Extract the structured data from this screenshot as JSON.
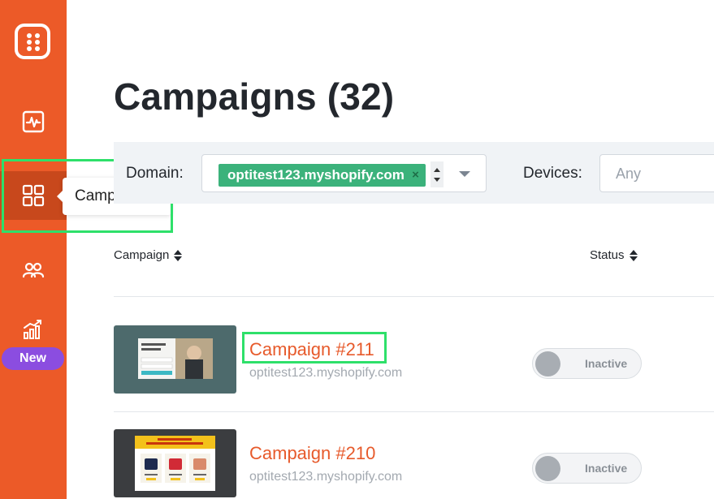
{
  "sidebar": {
    "new_badge": "New",
    "colors": {
      "background": "#ec5a28",
      "active": "#c8481c",
      "badge": "#8b4de0"
    },
    "items": [
      {
        "icon": "analytics-icon"
      },
      {
        "icon": "grid-icon",
        "active": true
      },
      {
        "icon": "users-icon"
      },
      {
        "icon": "bar-chart-icon"
      }
    ]
  },
  "tooltip": {
    "text": "Campaigns"
  },
  "page": {
    "title": "Campaigns (32)"
  },
  "filters": {
    "domain_label": "Domain:",
    "domain_tag": "optitest123.myshopify.com",
    "domain_tag_remove": "×",
    "devices_label": "Devices:",
    "devices_placeholder": "Any"
  },
  "table": {
    "headers": {
      "campaign": "Campaign",
      "status": "Status"
    },
    "rows": [
      {
        "name": "Campaign #211",
        "domain": "optitest123.myshopify.com",
        "status": "Inactive",
        "enabled": false
      },
      {
        "name": "Campaign #210",
        "domain": "optitest123.myshopify.com",
        "status": "Inactive",
        "enabled": false
      }
    ]
  },
  "colors": {
    "accent": "#e75a2b",
    "tag": "#3bb27b",
    "highlight": "#2ee06a"
  }
}
